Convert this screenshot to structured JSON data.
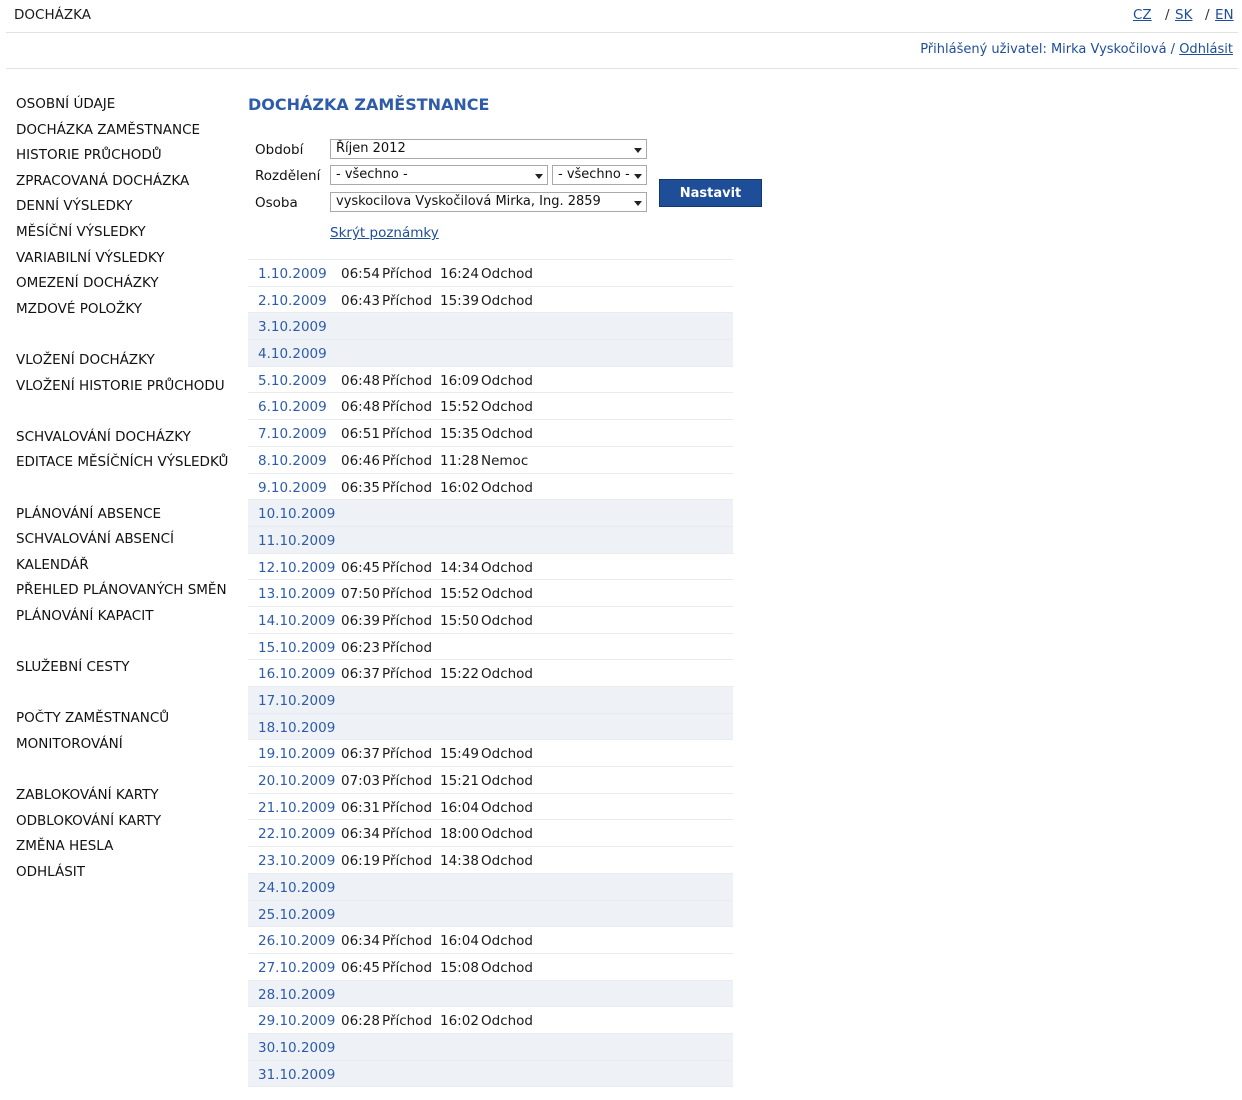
{
  "app_title": "DOCHÁZKA",
  "languages": [
    "CZ",
    "SK",
    "EN"
  ],
  "lang_separator": "/",
  "user_bar": {
    "prefix": "Přihlášený uživatel: Mirka Vyskočilová /",
    "logout": "Odhlásit"
  },
  "nav": [
    "OSOBNÍ ÚDAJE",
    "DOCHÁZKA ZAMĚSTNANCE",
    "HISTORIE PRŮCHODŮ",
    "ZPRACOVANÁ DOCHÁZKA",
    "DENNÍ VÝSLEDKY",
    "MĚSÍČNÍ VÝSLEDKY",
    "VARIABILNÍ VÝSLEDKY",
    "OMEZENÍ DOCHÁZKY",
    "MZDOVÉ POLOŽKY",
    "",
    "VLOŽENÍ DOCHÁZKY",
    "VLOŽENÍ HISTORIE PRŮCHODU",
    "",
    "SCHVALOVÁNÍ DOCHÁZKY",
    "EDITACE MĚSÍČNÍCH VÝSLEDKŮ",
    "",
    "PLÁNOVÁNÍ ABSENCE",
    "SCHVALOVÁNÍ ABSENCÍ",
    "KALENDÁŘ",
    "PŘEHLED PLÁNOVANÝCH SMĚN",
    "PLÁNOVÁNÍ KAPACIT",
    "",
    "SLUŽEBNÍ CESTY",
    "",
    "POČTY ZAMĚSTNANCŮ",
    "MONITOROVÁNÍ",
    "",
    "ZABLOKOVÁNÍ KARTY",
    "ODBLOKOVÁNÍ KARTY",
    "ZMĚNA HESLA",
    "ODHLÁSIT"
  ],
  "page_title": "DOCHÁZKA ZAMĚSTNANCE",
  "filters": {
    "period_label": "Období",
    "period_value": "Říjen 2012",
    "division_label": "Rozdělení",
    "division_value_1": "- všechno -",
    "division_value_2": "- všechno -",
    "person_label": "Osoba",
    "person_value": "vyskocilova Vyskočilová Mirka, Ing. 2859",
    "submit": "Nastavit",
    "hide_notes": "Skrýt poznámky"
  },
  "rows": [
    {
      "date": "1.10.2009",
      "t1": "06:54",
      "a1": "Příchod",
      "t2": "16:24",
      "a2": "Odchod",
      "weekend": false
    },
    {
      "date": "2.10.2009",
      "t1": "06:43",
      "a1": "Příchod",
      "t2": "15:39",
      "a2": "Odchod",
      "weekend": false
    },
    {
      "date": "3.10.2009",
      "t1": "",
      "a1": "",
      "t2": "",
      "a2": "",
      "weekend": true
    },
    {
      "date": "4.10.2009",
      "t1": "",
      "a1": "",
      "t2": "",
      "a2": "",
      "weekend": true
    },
    {
      "date": "5.10.2009",
      "t1": "06:48",
      "a1": "Příchod",
      "t2": "16:09",
      "a2": "Odchod",
      "weekend": false
    },
    {
      "date": "6.10.2009",
      "t1": "06:48",
      "a1": "Příchod",
      "t2": "15:52",
      "a2": "Odchod",
      "weekend": false
    },
    {
      "date": "7.10.2009",
      "t1": "06:51",
      "a1": "Příchod",
      "t2": "15:35",
      "a2": "Odchod",
      "weekend": false
    },
    {
      "date": "8.10.2009",
      "t1": "06:46",
      "a1": "Příchod",
      "t2": "11:28",
      "a2": "Nemoc",
      "weekend": false
    },
    {
      "date": "9.10.2009",
      "t1": "06:35",
      "a1": "Příchod",
      "t2": "16:02",
      "a2": "Odchod",
      "weekend": false
    },
    {
      "date": "10.10.2009",
      "t1": "",
      "a1": "",
      "t2": "",
      "a2": "",
      "weekend": true
    },
    {
      "date": "11.10.2009",
      "t1": "",
      "a1": "",
      "t2": "",
      "a2": "",
      "weekend": true
    },
    {
      "date": "12.10.2009",
      "t1": "06:45",
      "a1": "Příchod",
      "t2": "14:34",
      "a2": "Odchod",
      "weekend": false
    },
    {
      "date": "13.10.2009",
      "t1": "07:50",
      "a1": "Příchod",
      "t2": "15:52",
      "a2": "Odchod",
      "weekend": false
    },
    {
      "date": "14.10.2009",
      "t1": "06:39",
      "a1": "Příchod",
      "t2": "15:50",
      "a2": "Odchod",
      "weekend": false
    },
    {
      "date": "15.10.2009",
      "t1": "06:23",
      "a1": "Příchod",
      "t2": "",
      "a2": "",
      "weekend": false
    },
    {
      "date": "16.10.2009",
      "t1": "06:37",
      "a1": "Příchod",
      "t2": "15:22",
      "a2": "Odchod",
      "weekend": false
    },
    {
      "date": "17.10.2009",
      "t1": "",
      "a1": "",
      "t2": "",
      "a2": "",
      "weekend": true
    },
    {
      "date": "18.10.2009",
      "t1": "",
      "a1": "",
      "t2": "",
      "a2": "",
      "weekend": true
    },
    {
      "date": "19.10.2009",
      "t1": "06:37",
      "a1": "Příchod",
      "t2": "15:49",
      "a2": "Odchod",
      "weekend": false
    },
    {
      "date": "20.10.2009",
      "t1": "07:03",
      "a1": "Příchod",
      "t2": "15:21",
      "a2": "Odchod",
      "weekend": false
    },
    {
      "date": "21.10.2009",
      "t1": "06:31",
      "a1": "Příchod",
      "t2": "16:04",
      "a2": "Odchod",
      "weekend": false
    },
    {
      "date": "22.10.2009",
      "t1": "06:34",
      "a1": "Příchod",
      "t2": "18:00",
      "a2": "Odchod",
      "weekend": false
    },
    {
      "date": "23.10.2009",
      "t1": "06:19",
      "a1": "Příchod",
      "t2": "14:38",
      "a2": "Odchod",
      "weekend": false
    },
    {
      "date": "24.10.2009",
      "t1": "",
      "a1": "",
      "t2": "",
      "a2": "",
      "weekend": true
    },
    {
      "date": "25.10.2009",
      "t1": "",
      "a1": "",
      "t2": "",
      "a2": "",
      "weekend": true
    },
    {
      "date": "26.10.2009",
      "t1": "06:34",
      "a1": "Příchod",
      "t2": "16:04",
      "a2": "Odchod",
      "weekend": false
    },
    {
      "date": "27.10.2009",
      "t1": "06:45",
      "a1": "Příchod",
      "t2": "15:08",
      "a2": "Odchod",
      "weekend": false
    },
    {
      "date": "28.10.2009",
      "t1": "",
      "a1": "",
      "t2": "",
      "a2": "",
      "weekend": true
    },
    {
      "date": "29.10.2009",
      "t1": "06:28",
      "a1": "Příchod",
      "t2": "16:02",
      "a2": "Odchod",
      "weekend": false
    },
    {
      "date": "30.10.2009",
      "t1": "",
      "a1": "",
      "t2": "",
      "a2": "",
      "weekend": true
    },
    {
      "date": "31.10.2009",
      "t1": "",
      "a1": "",
      "t2": "",
      "a2": "",
      "weekend": true
    }
  ],
  "colors": {
    "accent": "#1f4e99",
    "title": "#2e5ca8",
    "weekend_row": "#eef2f6"
  }
}
